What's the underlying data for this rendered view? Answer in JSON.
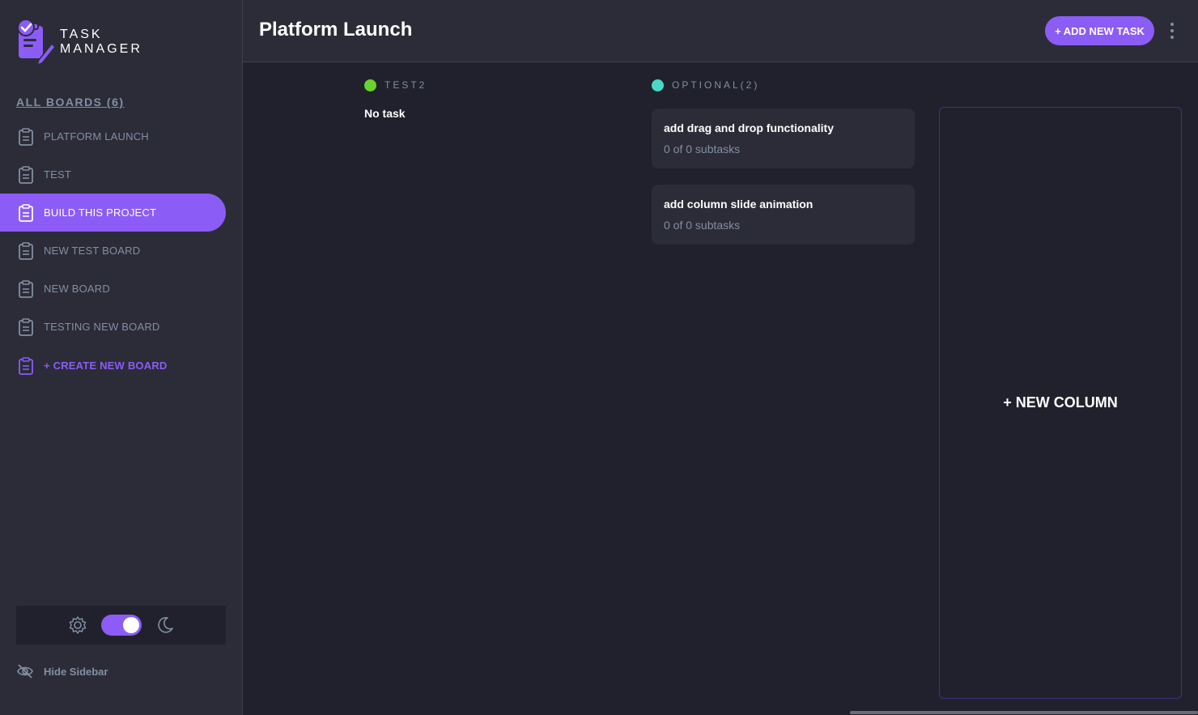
{
  "app": {
    "logo_line1": "TASK",
    "logo_line2": "MANAGER"
  },
  "sidebar": {
    "all_boards_label": "ALL BOARDS (6)",
    "boards": [
      {
        "label": "PLATFORM LAUNCH",
        "active": false
      },
      {
        "label": "TEST",
        "active": false
      },
      {
        "label": "BUILD THIS PROJECT",
        "active": true
      },
      {
        "label": "NEW TEST BOARD",
        "active": false
      },
      {
        "label": "NEW BOARD",
        "active": false
      },
      {
        "label": "TESTING NEW BOARD",
        "active": false
      }
    ],
    "create_label": "+ CREATE NEW BOARD",
    "hide_label": "Hide Sidebar",
    "theme": {
      "dark_mode": true
    }
  },
  "header": {
    "title": "Platform Launch",
    "add_task_label": "+ ADD NEW TASK"
  },
  "board": {
    "columns": [
      {
        "name": "TEST2",
        "color": "#67d32b",
        "empty_text": "No task",
        "tasks": []
      },
      {
        "name": "OPTIONAL(2)",
        "color": "#49c4e5",
        "tasks": [
          {
            "title": "add drag and drop functionality",
            "subtasks": "0 of 0 subtasks"
          },
          {
            "title": "add column slide animation",
            "subtasks": "0 of 0 subtasks"
          }
        ]
      }
    ],
    "new_column_label": "+ NEW COLUMN"
  },
  "colors": {
    "accent": "#8c5cf6",
    "background": "#20212c",
    "surface": "#2b2c37",
    "muted_text": "#828fa3"
  }
}
